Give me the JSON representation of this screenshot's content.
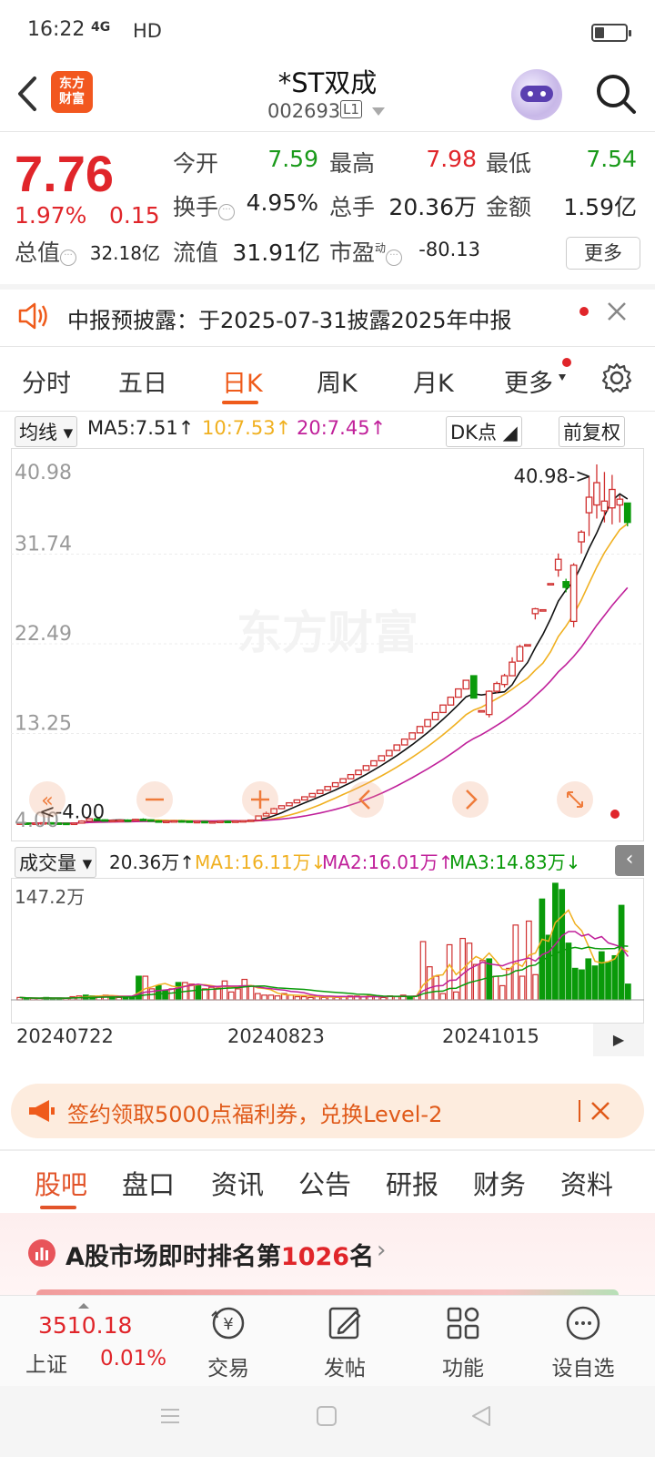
{
  "status_bar": {
    "time": "16:22",
    "network": "4G",
    "hd": "HD"
  },
  "header": {
    "logo_text": "东方\n财富",
    "stock_name": "*ST双成",
    "stock_code": "002693",
    "level": "L1"
  },
  "quote": {
    "price": "7.76",
    "change_pct": "1.97%",
    "change": "0.15",
    "fields": [
      {
        "label": "今开",
        "value": "7.59",
        "color": "#1a9a1a"
      },
      {
        "label": "最高",
        "value": "7.98",
        "color": "#e0252a"
      },
      {
        "label": "最低",
        "value": "7.54",
        "color": "#1a9a1a"
      },
      {
        "label": "换手",
        "value": "4.95%",
        "color": "#222222"
      },
      {
        "label": "总手",
        "value": "20.36万",
        "color": "#222222"
      },
      {
        "label": "金额",
        "value": "1.59亿",
        "color": "#222222"
      },
      {
        "label": "总值",
        "value": "32.18亿",
        "color": "#222222"
      },
      {
        "label": "流值",
        "value": "31.91亿",
        "color": "#222222"
      },
      {
        "label": "市盈",
        "value": "-80.13",
        "color": "#222222"
      }
    ],
    "pe_superscript": "动",
    "more_label": "更多"
  },
  "notice": {
    "text": "中报预披露：于2025-07-31披露2025年中报"
  },
  "chart_tabs": [
    "分时",
    "五日",
    "日K",
    "周K",
    "月K",
    "更多"
  ],
  "chart_tabs_active": "日K",
  "ma_row": {
    "selector": "均线",
    "ma5": "MA5:7.51",
    "ma10": "10:7.53",
    "ma20": "20:7.45",
    "dk": "DK点",
    "adjust": "前复权"
  },
  "volume_row": {
    "selector": "成交量",
    "vol": "20.36万",
    "ma1": "MA1:16.11万",
    "ma2": "MA2:16.01万",
    "ma3": "MA3:14.83万"
  },
  "chart_data": {
    "type": "candlestick",
    "y_ticks": [
      "40.98",
      "31.74",
      "22.49",
      "13.25",
      "4.00"
    ],
    "ylim": [
      4.0,
      40.98
    ],
    "annotations": [
      "40.98->",
      "<-4.00"
    ],
    "watermark": "东方财富",
    "volume_max_label": "147.2万",
    "x_dates": [
      "20240722",
      "20240823",
      "20241015"
    ],
    "colors": {
      "up": "#d03030",
      "down": "#0a9a0a",
      "ma5": "#111111",
      "ma10": "#f0b020",
      "ma20": "#c0209a"
    },
    "candles": [
      {
        "o": 4.0,
        "h": 4.05,
        "l": 3.97,
        "c": 4.02
      },
      {
        "o": 4.02,
        "h": 4.06,
        "l": 3.98,
        "c": 4.0
      },
      {
        "o": 4.0,
        "h": 4.04,
        "l": 3.96,
        "c": 4.01
      },
      {
        "o": 4.01,
        "h": 4.08,
        "l": 3.99,
        "c": 4.05
      },
      {
        "o": 4.05,
        "h": 4.1,
        "l": 4.0,
        "c": 4.02
      },
      {
        "o": 4.02,
        "h": 4.05,
        "l": 3.98,
        "c": 4.0
      },
      {
        "o": 4.0,
        "h": 4.02,
        "l": 3.97,
        "c": 3.99
      },
      {
        "o": 3.99,
        "h": 4.03,
        "l": 3.96,
        "c": 4.01
      },
      {
        "o": 4.01,
        "h": 4.3,
        "l": 4.0,
        "c": 4.22
      },
      {
        "o": 4.22,
        "h": 4.5,
        "l": 4.18,
        "c": 4.45
      },
      {
        "o": 4.45,
        "h": 4.5,
        "l": 4.3,
        "c": 4.35
      },
      {
        "o": 4.35,
        "h": 4.4,
        "l": 4.2,
        "c": 4.25
      },
      {
        "o": 4.25,
        "h": 4.35,
        "l": 4.15,
        "c": 4.3
      },
      {
        "o": 4.3,
        "h": 4.38,
        "l": 4.22,
        "c": 4.32
      },
      {
        "o": 4.32,
        "h": 4.4,
        "l": 4.25,
        "c": 4.28
      },
      {
        "o": 4.28,
        "h": 4.45,
        "l": 4.24,
        "c": 4.4
      },
      {
        "o": 4.4,
        "h": 4.5,
        "l": 4.3,
        "c": 4.34
      },
      {
        "o": 4.34,
        "h": 4.4,
        "l": 4.2,
        "c": 4.24
      },
      {
        "o": 4.24,
        "h": 4.3,
        "l": 4.1,
        "c": 4.18
      },
      {
        "o": 4.18,
        "h": 4.25,
        "l": 4.08,
        "c": 4.2
      },
      {
        "o": 4.2,
        "h": 4.3,
        "l": 4.15,
        "c": 4.25
      },
      {
        "o": 4.25,
        "h": 4.32,
        "l": 4.18,
        "c": 4.22
      },
      {
        "o": 4.22,
        "h": 4.28,
        "l": 4.1,
        "c": 4.15
      },
      {
        "o": 4.15,
        "h": 4.22,
        "l": 4.05,
        "c": 4.18
      },
      {
        "o": 4.18,
        "h": 4.25,
        "l": 4.1,
        "c": 4.12
      },
      {
        "o": 4.12,
        "h": 4.2,
        "l": 4.05,
        "c": 4.15
      },
      {
        "o": 4.15,
        "h": 4.22,
        "l": 4.1,
        "c": 4.2
      },
      {
        "o": 4.2,
        "h": 4.26,
        "l": 4.14,
        "c": 4.18
      },
      {
        "o": 4.18,
        "h": 4.24,
        "l": 4.1,
        "c": 4.22
      },
      {
        "o": 4.22,
        "h": 4.3,
        "l": 4.18,
        "c": 4.26
      },
      {
        "o": 4.26,
        "h": 4.35,
        "l": 4.2,
        "c": 4.32
      },
      {
        "o": 4.32,
        "h": 4.8,
        "l": 4.3,
        "c": 4.75
      },
      {
        "o": 4.75,
        "h": 5.2,
        "l": 4.7,
        "c": 5.0
      },
      {
        "o": 5.0,
        "h": 5.6,
        "l": 4.95,
        "c": 5.5
      },
      {
        "o": 5.5,
        "h": 5.8,
        "l": 5.45,
        "c": 5.8
      },
      {
        "o": 5.8,
        "h": 6.1,
        "l": 5.8,
        "c": 6.1
      },
      {
        "o": 6.1,
        "h": 6.4,
        "l": 6.1,
        "c": 6.4
      },
      {
        "o": 6.4,
        "h": 6.75,
        "l": 6.4,
        "c": 6.72
      },
      {
        "o": 6.72,
        "h": 7.06,
        "l": 6.72,
        "c": 7.06
      },
      {
        "o": 7.06,
        "h": 7.41,
        "l": 7.06,
        "c": 7.41
      },
      {
        "o": 7.41,
        "h": 7.78,
        "l": 7.41,
        "c": 7.78
      },
      {
        "o": 7.78,
        "h": 8.17,
        "l": 7.78,
        "c": 8.17
      },
      {
        "o": 8.17,
        "h": 8.58,
        "l": 8.17,
        "c": 8.58
      },
      {
        "o": 8.58,
        "h": 9.01,
        "l": 8.58,
        "c": 9.01
      },
      {
        "o": 9.01,
        "h": 9.46,
        "l": 9.01,
        "c": 9.46
      },
      {
        "o": 9.46,
        "h": 9.93,
        "l": 9.46,
        "c": 9.93
      },
      {
        "o": 9.93,
        "h": 10.43,
        "l": 9.93,
        "c": 10.43
      },
      {
        "o": 10.43,
        "h": 10.95,
        "l": 10.43,
        "c": 10.95
      },
      {
        "o": 10.95,
        "h": 11.5,
        "l": 10.95,
        "c": 11.5
      },
      {
        "o": 11.5,
        "h": 12.07,
        "l": 11.5,
        "c": 12.07
      },
      {
        "o": 12.07,
        "h": 12.67,
        "l": 12.07,
        "c": 12.67
      },
      {
        "o": 12.67,
        "h": 13.31,
        "l": 12.67,
        "c": 13.31
      },
      {
        "o": 13.31,
        "h": 13.97,
        "l": 13.31,
        "c": 13.97
      },
      {
        "o": 13.97,
        "h": 14.67,
        "l": 13.97,
        "c": 14.67
      },
      {
        "o": 14.67,
        "h": 15.41,
        "l": 14.67,
        "c": 15.41
      },
      {
        "o": 15.41,
        "h": 16.18,
        "l": 15.41,
        "c": 16.18
      },
      {
        "o": 16.18,
        "h": 16.99,
        "l": 16.18,
        "c": 16.99
      },
      {
        "o": 16.99,
        "h": 17.84,
        "l": 16.99,
        "c": 17.84
      },
      {
        "o": 17.84,
        "h": 18.73,
        "l": 17.84,
        "c": 18.73
      },
      {
        "o": 19.2,
        "h": 19.2,
        "l": 16.9,
        "c": 16.9
      },
      {
        "o": 15.6,
        "h": 15.6,
        "l": 15.6,
        "c": 15.6
      },
      {
        "o": 15.2,
        "h": 17.7,
        "l": 14.9,
        "c": 17.6
      },
      {
        "o": 17.6,
        "h": 18.6,
        "l": 17.4,
        "c": 18.4
      },
      {
        "o": 18.3,
        "h": 19.4,
        "l": 18.0,
        "c": 19.2
      },
      {
        "o": 19.2,
        "h": 21.1,
        "l": 19.2,
        "c": 20.6
      },
      {
        "o": 20.7,
        "h": 22.4,
        "l": 20.7,
        "c": 22.2
      },
      {
        "o": 22.4,
        "h": 22.4,
        "l": 22.4,
        "c": 22.4
      },
      {
        "o": 25.6,
        "h": 26.2,
        "l": 25.0,
        "c": 26.1
      },
      {
        "o": 26.0,
        "h": 26.0,
        "l": 26.0,
        "c": 26.0
      },
      {
        "o": 28.7,
        "h": 28.7,
        "l": 28.7,
        "c": 28.7
      },
      {
        "o": 30.1,
        "h": 31.8,
        "l": 29.4,
        "c": 31.2
      },
      {
        "o": 28.9,
        "h": 29.2,
        "l": 27.8,
        "c": 28.3
      },
      {
        "o": 24.8,
        "h": 30.8,
        "l": 24.2,
        "c": 30.6
      },
      {
        "o": 33.0,
        "h": 34.2,
        "l": 31.8,
        "c": 34.0
      },
      {
        "o": 36.0,
        "h": 39.8,
        "l": 33.6,
        "c": 37.6
      },
      {
        "o": 36.8,
        "h": 40.98,
        "l": 35.4,
        "c": 39.1
      },
      {
        "o": 36.2,
        "h": 40.2,
        "l": 35.0,
        "c": 37.2
      },
      {
        "o": 36.5,
        "h": 39.9,
        "l": 34.8,
        "c": 38.4
      },
      {
        "o": 36.8,
        "h": 37.8,
        "l": 35.0,
        "c": 37.4
      },
      {
        "o": 37.0,
        "h": 37.0,
        "l": 34.6,
        "c": 35.0
      }
    ],
    "volume": [
      3,
      2,
      2,
      2,
      3,
      2,
      2,
      2,
      4,
      5,
      6,
      5,
      5,
      6,
      5,
      3,
      4,
      4,
      30,
      30,
      14,
      18,
      12,
      14,
      22,
      22,
      20,
      18,
      14,
      16,
      15,
      24,
      10,
      14,
      26,
      18,
      8,
      6,
      6,
      5,
      8,
      6,
      4,
      4,
      3,
      4,
      3,
      4,
      3,
      4,
      5,
      5,
      4,
      6,
      4,
      3,
      5,
      4,
      6,
      4,
      5,
      74,
      42,
      30,
      8,
      70,
      10,
      78,
      72,
      45,
      50,
      52,
      30,
      18,
      40,
      95,
      30,
      100,
      32,
      128,
      82,
      148,
      140,
      72,
      40,
      38,
      52,
      43,
      61,
      48,
      56,
      120,
      20
    ]
  },
  "promo": {
    "text": "签约领取5000点福利券，兑换Level-2"
  },
  "bottom_tabs": [
    "股吧",
    "盘口",
    "资讯",
    "公告",
    "研报",
    "财务",
    "资料"
  ],
  "bottom_tabs_active": "股吧",
  "rank": {
    "prefix": "A股市场即时排名第",
    "number": "1026",
    "suffix": "名"
  },
  "bottom_nav": {
    "index_value": "3510.18",
    "index_name": "上证",
    "index_change": "0.01%",
    "items": [
      {
        "label": "交易",
        "icon": "trade-icon"
      },
      {
        "label": "发帖",
        "icon": "edit-icon"
      },
      {
        "label": "功能",
        "icon": "apps-icon"
      },
      {
        "label": "设自选",
        "icon": "more-circle-icon"
      }
    ]
  }
}
